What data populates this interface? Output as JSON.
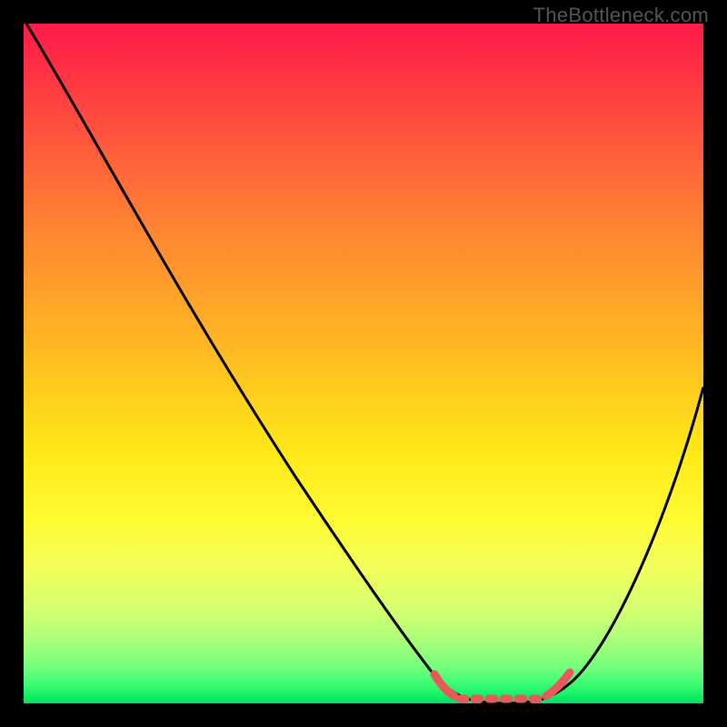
{
  "watermark": "TheBottleneck.com",
  "chart_data": {
    "type": "line",
    "title": "",
    "xlabel": "",
    "ylabel": "",
    "xlim": [
      0,
      100
    ],
    "ylim": [
      0,
      100
    ],
    "grid": false,
    "legend": false,
    "series": [
      {
        "name": "curve",
        "x": [
          0,
          5,
          10,
          15,
          20,
          25,
          30,
          35,
          40,
          45,
          50,
          55,
          60,
          63,
          66,
          70,
          74,
          78,
          82,
          86,
          90,
          94,
          98,
          100
        ],
        "y": [
          100,
          94,
          88,
          81,
          73,
          65,
          57,
          49,
          41,
          33,
          25,
          17,
          9,
          4,
          1,
          0,
          0,
          1,
          6,
          14,
          23,
          33,
          44,
          50
        ]
      }
    ],
    "background_gradient": {
      "direction": "vertical",
      "stops": [
        {
          "pos": 0.0,
          "color": "#ff1a4b"
        },
        {
          "pos": 0.5,
          "color": "#ffc61f"
        },
        {
          "pos": 0.8,
          "color": "#f2ff5a"
        },
        {
          "pos": 1.0,
          "color": "#00e060"
        }
      ]
    },
    "highlight_segment": {
      "x_start": 62,
      "x_end": 80,
      "color": "#e85a5a"
    }
  }
}
